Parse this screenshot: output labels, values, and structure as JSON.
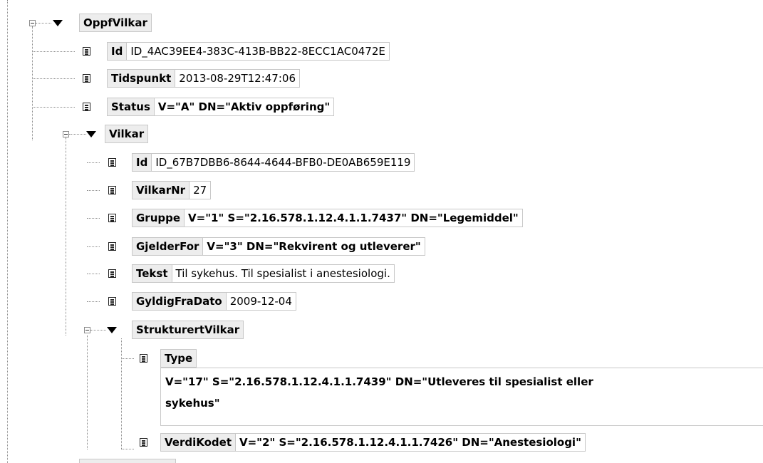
{
  "tree": {
    "oppfvilkar": {
      "name": "OppfVilkar"
    },
    "id1": {
      "name": "Id",
      "value": "ID_4AC39EE4-383C-413B-BB22-8ECC1AC0472E"
    },
    "tidspunkt": {
      "name": "Tidspunkt",
      "value": "2013-08-29T12:47:06"
    },
    "status": {
      "name": "Status",
      "value": "V=\"A\" DN=\"Aktiv oppføring\""
    },
    "vilkar": {
      "name": "Vilkar"
    },
    "id2": {
      "name": "Id",
      "value": "ID_67B7DBB6-8644-4644-BFB0-DE0AB659E119"
    },
    "vilkarnr": {
      "name": "VilkarNr",
      "value": "27"
    },
    "gruppe": {
      "name": "Gruppe",
      "value": "V=\"1\" S=\"2.16.578.1.12.4.1.1.7437\" DN=\"Legemiddel\""
    },
    "gjelderfor": {
      "name": "GjelderFor",
      "value": "V=\"3\" DN=\"Rekvirent og utleverer\""
    },
    "tekst": {
      "name": "Tekst",
      "value": "Til sykehus. Til spesialist i anestesiologi."
    },
    "gyldigfradato": {
      "name": "GyldigFraDato",
      "value": "2009-12-04"
    },
    "strukturertvilkar": {
      "name": "StrukturertVilkar"
    },
    "type": {
      "name": "Type",
      "value_line1": "V=\"17\" S=\"2.16.578.1.12.4.1.1.7439\" DN=\"Utleveres til spesialist eller",
      "value_line2": "sykehus\""
    },
    "verdikodet": {
      "name": "VerdiKodet",
      "value": "V=\"2\" S=\"2.16.578.1.12.4.1.1.7426\" DN=\"Anestesiologi\""
    }
  }
}
